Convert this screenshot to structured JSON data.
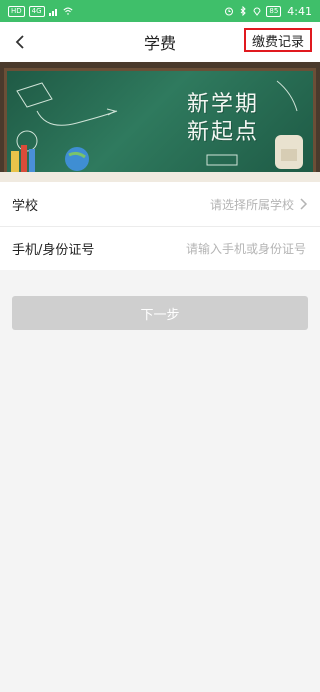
{
  "status_bar": {
    "left_chip_1": "HD",
    "left_chip_2": "4G",
    "battery": "85",
    "time": "4:41"
  },
  "nav": {
    "title": "学费",
    "records_label": "缴费记录"
  },
  "banner": {
    "line1": "新学期",
    "line2": "新起点"
  },
  "form": {
    "school": {
      "label": "学校",
      "placeholder": "请选择所属学校"
    },
    "id": {
      "label": "手机/身份证号",
      "placeholder": "请输入手机或身份证号"
    }
  },
  "next_button": "下一步",
  "colors": {
    "status_bar": "#3fbf6a",
    "highlight_border": "#e0191f",
    "button_disabled": "#cfcfcf"
  }
}
